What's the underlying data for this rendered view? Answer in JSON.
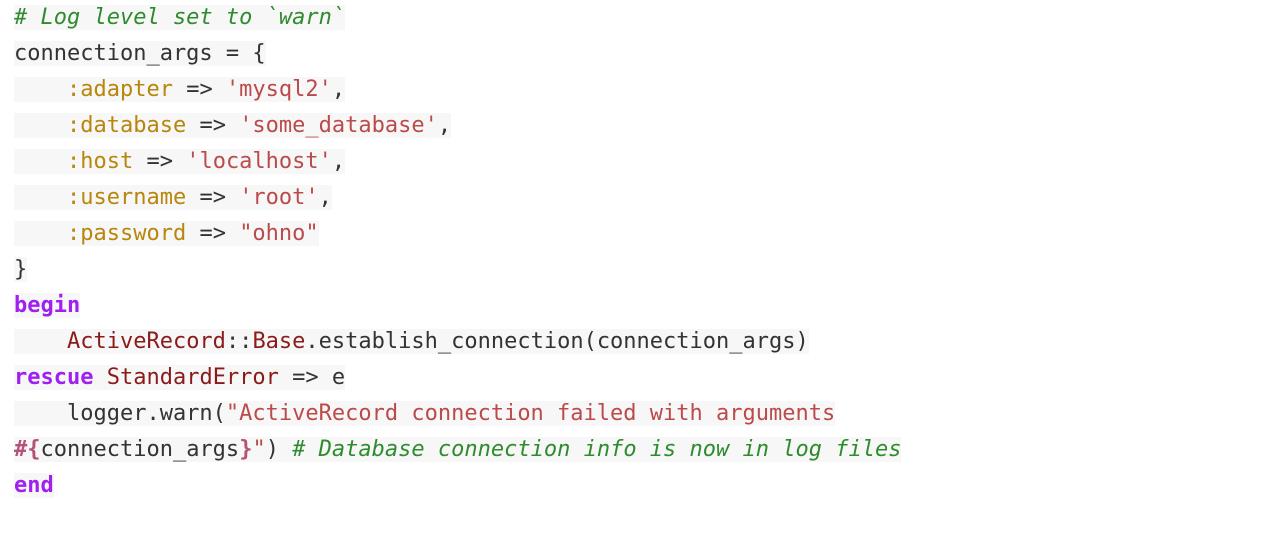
{
  "document": {
    "language": "ruby",
    "title": "Ruby ActiveRecord connection logging snippet",
    "font_size_px": 22,
    "line_height_px": 36,
    "background_color": "#ffffff",
    "highlight_color": "#f7f7f7"
  },
  "theme": {
    "plain": "#333333",
    "comment": "#2e8b2e",
    "symbol": "#b8860b",
    "string": "#bb4a4a",
    "constant": "#8b1a1a",
    "keyword": "#a020f0",
    "interpolation": "#b5527a"
  },
  "code": {
    "plain_text": "# Log level set to `warn`\nconnection_args = {\n    :adapter => 'mysql2',\n    :database => 'some_database',\n    :host => 'localhost',\n    :username => 'root',\n    :password => \"ohno\"\n}\nbegin\n    ActiveRecord::Base.establish_connection(connection_args)\nrescue StandardError => e\n    logger.warn(\"ActiveRecord connection failed with arguments #{connection_args}\") # Database connection info is now in log files\nend",
    "lines": [
      {
        "index": 0,
        "tokens": [
          {
            "text": "# Log level set to `warn`",
            "type": "comment"
          }
        ]
      },
      {
        "index": 1,
        "tokens": [
          {
            "text": "connection_args = {",
            "type": "plain"
          }
        ]
      },
      {
        "index": 2,
        "tokens": [
          {
            "text": "    ",
            "type": "plain"
          },
          {
            "text": ":adapter",
            "type": "symbol"
          },
          {
            "text": " => ",
            "type": "plain"
          },
          {
            "text": "'mysql2'",
            "type": "string"
          },
          {
            "text": ",",
            "type": "plain"
          }
        ]
      },
      {
        "index": 3,
        "tokens": [
          {
            "text": "    ",
            "type": "plain"
          },
          {
            "text": ":database",
            "type": "symbol"
          },
          {
            "text": " => ",
            "type": "plain"
          },
          {
            "text": "'some_database'",
            "type": "string"
          },
          {
            "text": ",",
            "type": "plain"
          }
        ]
      },
      {
        "index": 4,
        "tokens": [
          {
            "text": "    ",
            "type": "plain"
          },
          {
            "text": ":host",
            "type": "symbol"
          },
          {
            "text": " => ",
            "type": "plain"
          },
          {
            "text": "'localhost'",
            "type": "string"
          },
          {
            "text": ",",
            "type": "plain"
          }
        ]
      },
      {
        "index": 5,
        "tokens": [
          {
            "text": "    ",
            "type": "plain"
          },
          {
            "text": ":username",
            "type": "symbol"
          },
          {
            "text": " => ",
            "type": "plain"
          },
          {
            "text": "'root'",
            "type": "string"
          },
          {
            "text": ",",
            "type": "plain"
          }
        ]
      },
      {
        "index": 6,
        "tokens": [
          {
            "text": "    ",
            "type": "plain"
          },
          {
            "text": ":password",
            "type": "symbol"
          },
          {
            "text": " => ",
            "type": "plain"
          },
          {
            "text": "\"ohno\"",
            "type": "string"
          }
        ]
      },
      {
        "index": 7,
        "tokens": [
          {
            "text": "}",
            "type": "plain"
          }
        ]
      },
      {
        "index": 8,
        "tokens": [
          {
            "text": "begin",
            "type": "keyword"
          }
        ]
      },
      {
        "index": 9,
        "tokens": [
          {
            "text": "    ",
            "type": "plain"
          },
          {
            "text": "ActiveRecord",
            "type": "constant"
          },
          {
            "text": "::",
            "type": "plain"
          },
          {
            "text": "Base",
            "type": "constant"
          },
          {
            "text": ".establish_connection(connection_args)",
            "type": "plain"
          }
        ]
      },
      {
        "index": 10,
        "tokens": [
          {
            "text": "rescue",
            "type": "keyword"
          },
          {
            "text": " ",
            "type": "plain"
          },
          {
            "text": "StandardError",
            "type": "constant"
          },
          {
            "text": " => e",
            "type": "plain"
          }
        ]
      },
      {
        "index": 11,
        "tokens": [
          {
            "text": "    logger.warn(",
            "type": "plain"
          },
          {
            "text": "\"ActiveRecord connection failed with arguments",
            "type": "string"
          }
        ]
      },
      {
        "index": 12,
        "tokens": [
          {
            "text": "#{",
            "type": "interpolation"
          },
          {
            "text": "connection_args",
            "type": "plain"
          },
          {
            "text": "}",
            "type": "interpolation"
          },
          {
            "text": "\"",
            "type": "string"
          },
          {
            "text": ")",
            "type": "plain"
          },
          {
            "text": " ",
            "type": "plain"
          },
          {
            "text": "# Database connection info is now in log files",
            "type": "comment"
          }
        ]
      },
      {
        "index": 13,
        "tokens": [
          {
            "text": "end",
            "type": "keyword"
          }
        ]
      }
    ]
  }
}
